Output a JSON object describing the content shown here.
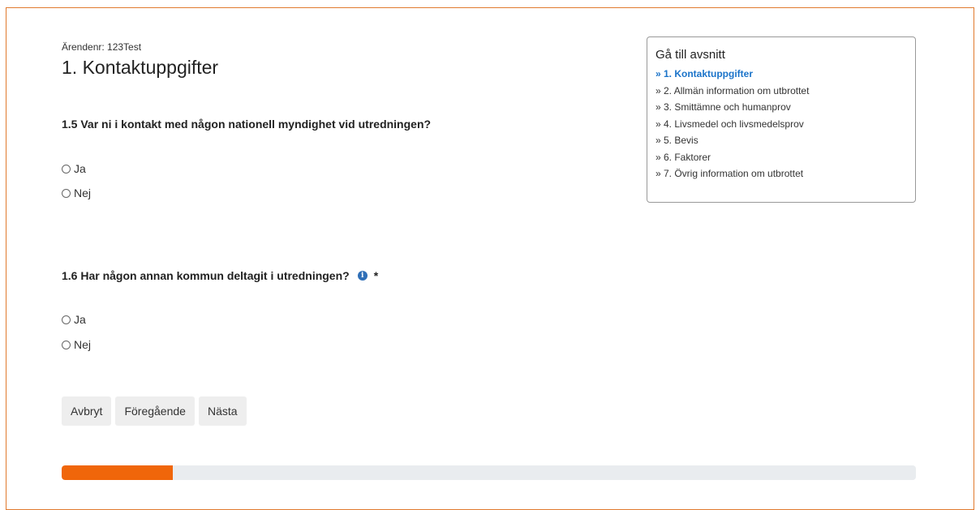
{
  "header": {
    "case_number": "Ärendenr: 123Test",
    "title": "1. Kontaktuppgifter"
  },
  "questions": [
    {
      "label": "1.5 Var ni i kontakt med någon nationell myndighet vid utredningen?",
      "options": [
        "Ja",
        "Nej"
      ]
    },
    {
      "label": "1.6 Har någon annan kommun deltagit i utredningen?",
      "info_icon": "i",
      "required": "*",
      "options": [
        "Ja",
        "Nej"
      ]
    }
  ],
  "buttons": {
    "cancel": "Avbryt",
    "previous": "Föregående",
    "next": "Nästa"
  },
  "progress": {
    "fraction": 0.13,
    "color": "#f0660a"
  },
  "toc": {
    "title": "Gå till avsnitt",
    "items": [
      "» 1. Kontaktuppgifter",
      "» 2. Allmän information om utbrottet",
      "» 3. Smittämne och humanprov",
      "» 4. Livsmedel och livsmedelsprov",
      "» 5. Bevis",
      "» 6. Faktorer",
      "» 7. Övrig information om utbrottet"
    ],
    "active_index": 0,
    "active_color": "#1a73c9"
  },
  "colors": {
    "frame_border": "#e07a2e",
    "button_bg": "#eeeeee"
  }
}
